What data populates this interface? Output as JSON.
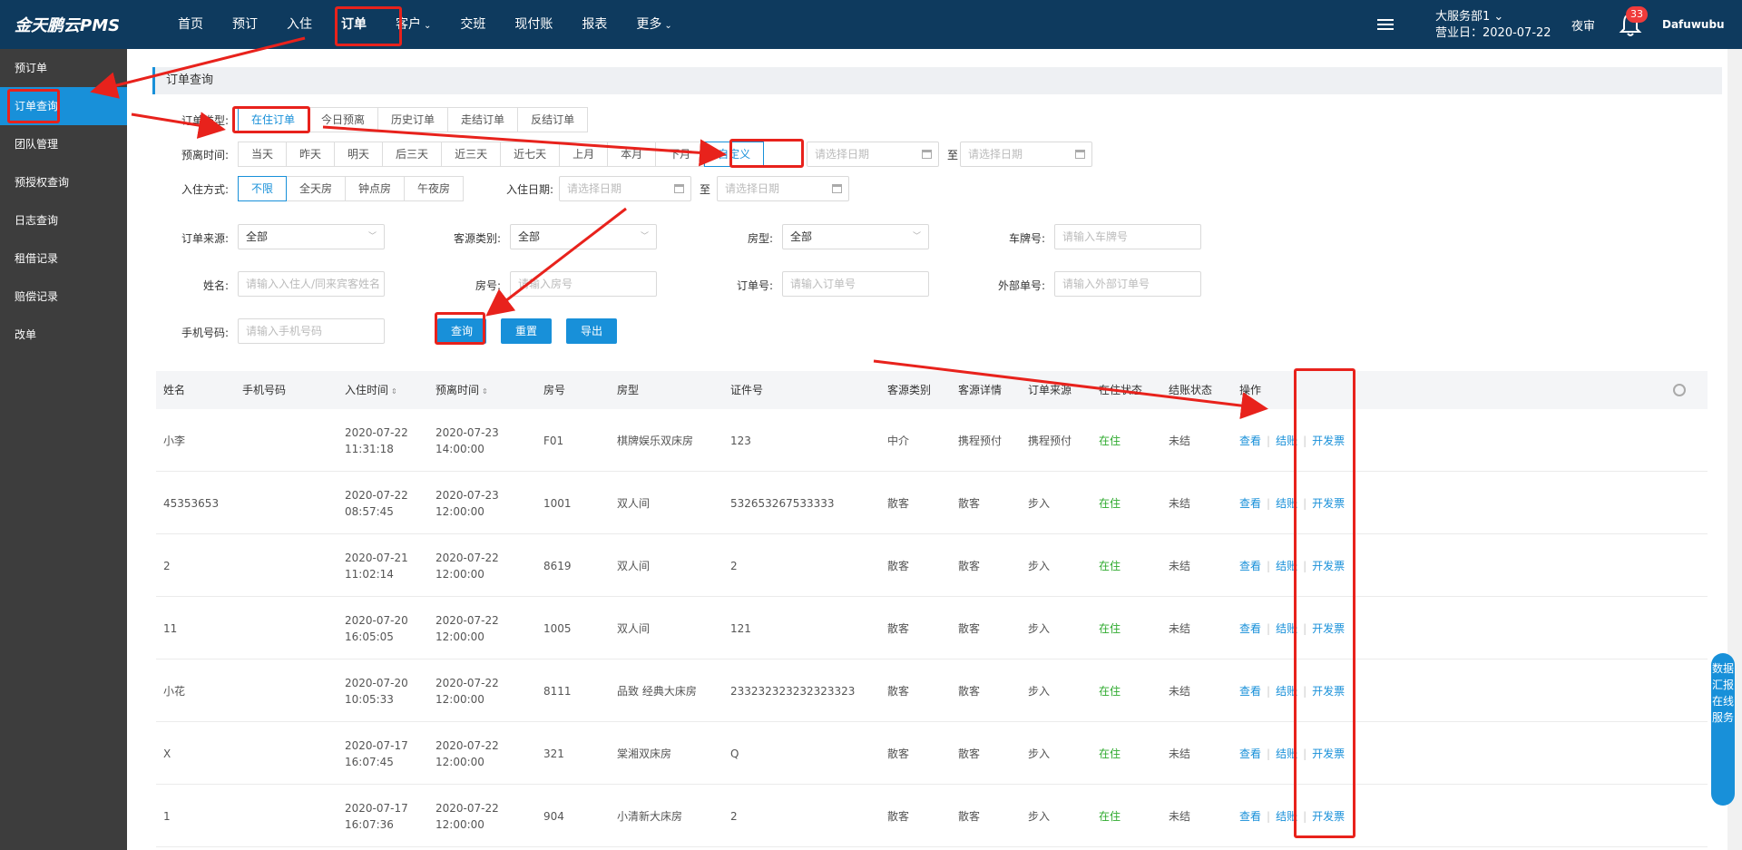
{
  "app": {
    "logo": "金天鹏云PMS"
  },
  "nav": {
    "items": [
      {
        "label": "首页",
        "chev": ""
      },
      {
        "label": "预订",
        "chev": ""
      },
      {
        "label": "入住",
        "chev": ""
      },
      {
        "label": "订单",
        "chev": ""
      },
      {
        "label": "客户",
        "chev": "⌄"
      },
      {
        "label": "交班",
        "chev": ""
      },
      {
        "label": "现付账",
        "chev": ""
      },
      {
        "label": "报表",
        "chev": ""
      },
      {
        "label": "更多",
        "chev": "⌄"
      }
    ],
    "active_index": 3
  },
  "header": {
    "store_name": "大服务部1 ⌄",
    "business_day": "营业日：2020-07-22",
    "night_audit": "夜审",
    "notification_count": "33",
    "username": "Dafuwubu"
  },
  "sidebar": {
    "items": [
      "预订单",
      "订单查询",
      "团队管理",
      "预授权查询",
      "日志查询",
      "租借记录",
      "赔偿记录",
      "改单"
    ],
    "active_index": 1
  },
  "page": {
    "title": "订单查询"
  },
  "filters": {
    "order_type_label": "订单类型:",
    "order_types": [
      "在住订单",
      "今日预离",
      "历史订单",
      "走结订单",
      "反结订单"
    ],
    "departure_label": "预离时间:",
    "departure_options": [
      "当天",
      "昨天",
      "明天",
      "后三天",
      "近三天",
      "近七天",
      "上月",
      "本月",
      "下月",
      "自定义"
    ],
    "checkin_mode_label": "入住方式:",
    "checkin_modes": [
      "不限",
      "全天房",
      "钟点房",
      "午夜房"
    ],
    "checkin_date_label": "入住日期:",
    "date_placeholder": "请选择日期",
    "to": "至",
    "order_source_label": "订单来源:",
    "order_source_value": "全部",
    "guest_type_label": "客源类别:",
    "guest_type_value": "全部",
    "room_type_label": "房型:",
    "room_type_value": "全部",
    "plate_label": "车牌号:",
    "plate_placeholder": "请输入车牌号",
    "name_label": "姓名:",
    "name_placeholder": "请输入入住人/同来宾客姓名",
    "room_no_label": "房号:",
    "room_no_placeholder": "请输入房号",
    "order_no_label": "订单号:",
    "order_no_placeholder": "请输入订单号",
    "external_no_label": "外部单号:",
    "external_no_placeholder": "请输入外部订单号",
    "phone_label": "手机号码:",
    "phone_placeholder": "请输入手机号码",
    "search_button": "查询",
    "reset_button": "重置",
    "export_button": "导出"
  },
  "table": {
    "headers": [
      "姓名",
      "手机号码",
      "入住时间",
      "预离时间",
      "房号",
      "房型",
      "证件号",
      "客源类别",
      "客源详情",
      "订单来源",
      "在住状态",
      "结账状态",
      "操作"
    ],
    "rows": [
      {
        "name": "小李",
        "phone": "",
        "checkin_date": "2020-07-22",
        "checkin_time": "11:31:18",
        "leave_date": "2020-07-23",
        "leave_time": "14:00:00",
        "room": "F01",
        "room_type": "棋牌娱乐双床房",
        "id_no": "123",
        "guest_type": "中介",
        "guest_detail": "携程预付",
        "source": "携程预付",
        "status": "在住",
        "settle": "未结"
      },
      {
        "name": "45353653",
        "phone": "",
        "checkin_date": "2020-07-22",
        "checkin_time": "08:57:45",
        "leave_date": "2020-07-23",
        "leave_time": "12:00:00",
        "room": "1001",
        "room_type": "双人间",
        "id_no": "532653267533333",
        "guest_type": "散客",
        "guest_detail": "散客",
        "source": "步入",
        "status": "在住",
        "settle": "未结"
      },
      {
        "name": "2",
        "phone": "",
        "checkin_date": "2020-07-21",
        "checkin_time": "11:02:14",
        "leave_date": "2020-07-22",
        "leave_time": "12:00:00",
        "room": "8619",
        "room_type": "双人间",
        "id_no": "2",
        "guest_type": "散客",
        "guest_detail": "散客",
        "source": "步入",
        "status": "在住",
        "settle": "未结"
      },
      {
        "name": "11",
        "phone": "",
        "checkin_date": "2020-07-20",
        "checkin_time": "16:05:05",
        "leave_date": "2020-07-22",
        "leave_time": "12:00:00",
        "room": "1005",
        "room_type": "双人间",
        "id_no": "121",
        "guest_type": "散客",
        "guest_detail": "散客",
        "source": "步入",
        "status": "在住",
        "settle": "未结"
      },
      {
        "name": "小花",
        "phone": "",
        "checkin_date": "2020-07-20",
        "checkin_time": "10:05:33",
        "leave_date": "2020-07-22",
        "leave_time": "12:00:00",
        "room": "8111",
        "room_type": "品致 经典大床房",
        "id_no": "233232323232323323",
        "guest_type": "散客",
        "guest_detail": "散客",
        "source": "步入",
        "status": "在住",
        "settle": "未结"
      },
      {
        "name": "X",
        "phone": "",
        "checkin_date": "2020-07-17",
        "checkin_time": "16:07:45",
        "leave_date": "2020-07-22",
        "leave_time": "12:00:00",
        "room": "321",
        "room_type": "棠湘双床房",
        "id_no": "Q",
        "guest_type": "散客",
        "guest_detail": "散客",
        "source": "步入",
        "status": "在住",
        "settle": "未结"
      },
      {
        "name": "1",
        "phone": "",
        "checkin_date": "2020-07-17",
        "checkin_time": "16:07:36",
        "leave_date": "2020-07-22",
        "leave_time": "12:00:00",
        "room": "904",
        "room_type": "小清新大床房",
        "id_no": "2",
        "guest_type": "散客",
        "guest_detail": "散客",
        "source": "步入",
        "status": "在住",
        "settle": "未结"
      }
    ],
    "actions": [
      "查看",
      "结账",
      "开发票"
    ]
  },
  "float_tab": {
    "label": "数据汇报 在线服务"
  },
  "colors": {
    "topbar": "#0e3a5e",
    "accent": "#1890d9",
    "sidebar": "#3d3d3d",
    "green": "#2eaa2e",
    "annotation": "#e8221c"
  }
}
